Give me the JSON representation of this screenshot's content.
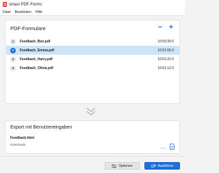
{
  "window": {
    "title": "smasi PDF-Forms"
  },
  "menu": [
    {
      "label": "Datei"
    },
    {
      "label": "Bearbeiten"
    },
    {
      "label": "Hilfe"
    }
  ],
  "pdf_panel": {
    "title": "PDF-Formulare",
    "remove_label": "−",
    "add_label": "+",
    "files": [
      {
        "num": "1",
        "name": "Feedback_Ben.pdf",
        "time": "10:00:39.0",
        "selected": false
      },
      {
        "num": "2",
        "name": "Feedback_Emma.pdf",
        "time": "10:01:55.0",
        "selected": true
      },
      {
        "num": "3",
        "name": "Feedback_Harry.pdf",
        "time": "10:01:22.0",
        "selected": false
      },
      {
        "num": "4",
        "name": "Feedback_Olivia.pdf",
        "time": "10:01:12.0",
        "selected": false
      }
    ]
  },
  "export_panel": {
    "title": "Export mit Benutzereingaben",
    "file": "Feedback.html",
    "folder": "Downloads",
    "more_label": "..."
  },
  "footer": {
    "options_label": "Optionen",
    "run_label": "Ausführen"
  },
  "colors": {
    "accent": "#1e6fd9",
    "selected_row": "#cce4f7",
    "app_icon": "#d9342b"
  }
}
